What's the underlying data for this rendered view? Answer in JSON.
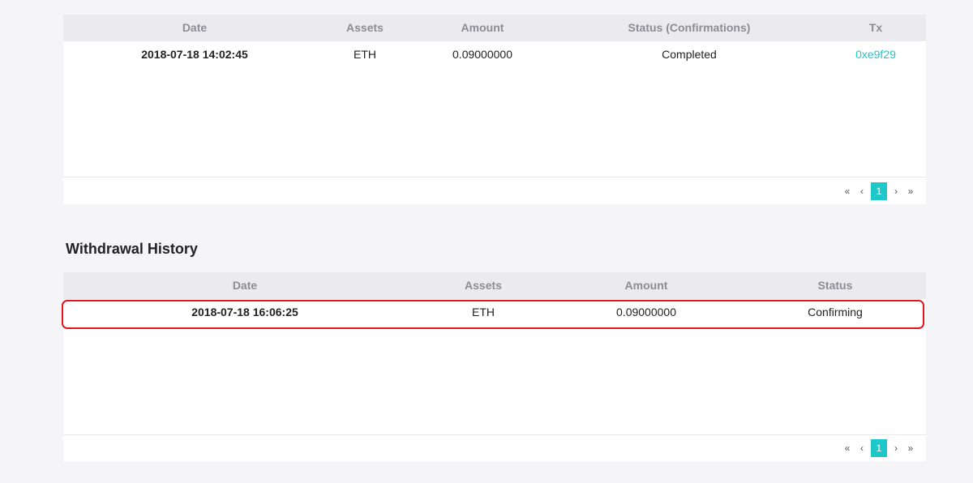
{
  "deposit": {
    "headers": [
      "Date",
      "Assets",
      "Amount",
      "Status (Confirmations)",
      "Tx"
    ],
    "rows": [
      {
        "date": "2018-07-18 14:02:45",
        "asset": "ETH",
        "amount": "0.09000000",
        "status": "Completed",
        "tx": "0xe9f29"
      }
    ],
    "pagination": {
      "first": "«",
      "prev": "‹",
      "current": "1",
      "next": "›",
      "last": "»"
    }
  },
  "withdrawal": {
    "title": "Withdrawal History",
    "headers": [
      "Date",
      "Assets",
      "Amount",
      "Status"
    ],
    "rows": [
      {
        "date": "2018-07-18 16:06:25",
        "asset": "ETH",
        "amount": "0.09000000",
        "status": "Confirming"
      }
    ],
    "pagination": {
      "first": "«",
      "prev": "‹",
      "current": "1",
      "next": "›",
      "last": "»"
    }
  },
  "colors": {
    "accent": "#1ec8c8",
    "highlight": "#e3161b",
    "header_bg": "#ebebef",
    "page_bg": "#f5f5f7"
  }
}
